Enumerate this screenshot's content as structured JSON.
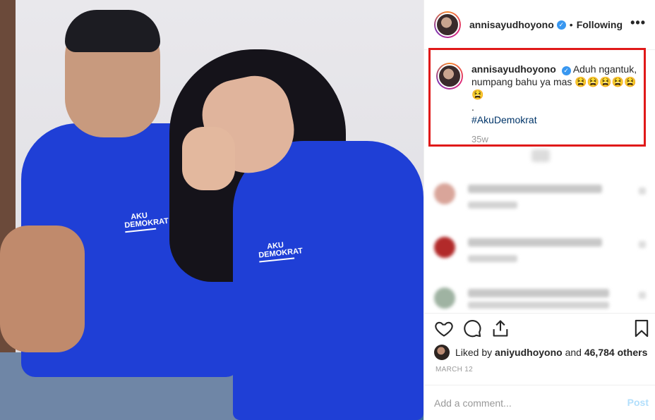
{
  "post": {
    "image_alt": "Couple in blue polo shirts"
  },
  "photo": {
    "logo_line1": "AKU",
    "logo_line2": "DEMOKRAT"
  },
  "header": {
    "username": "annisayudhoyono",
    "verified_icon": "verified-badge-icon",
    "separator": "•",
    "follow_status": "Following",
    "more_icon": "•••"
  },
  "caption": {
    "username": "annisayudhoyono",
    "text": "Aduh ngantuk, numpang bahu ya mas 😫😫😫😫😫😫",
    "dot": ".",
    "hashtag": "#AkuDemokrat",
    "time": "35w"
  },
  "actions": {
    "like_icon": "heart-icon",
    "comment_icon": "comment-icon",
    "share_icon": "share-icon",
    "save_icon": "bookmark-icon"
  },
  "likes": {
    "prefix": "Liked by",
    "user": "aniyudhoyono",
    "and": "and",
    "others": "46,784 others"
  },
  "date": "MARCH 12",
  "comment_box": {
    "placeholder": "Add a comment...",
    "post_label": "Post"
  },
  "colors": {
    "accent": "#3897f0",
    "highlight_box": "#e01919",
    "post_disabled": "#b2dffc",
    "shirt_blue": "#1f3fd6"
  }
}
